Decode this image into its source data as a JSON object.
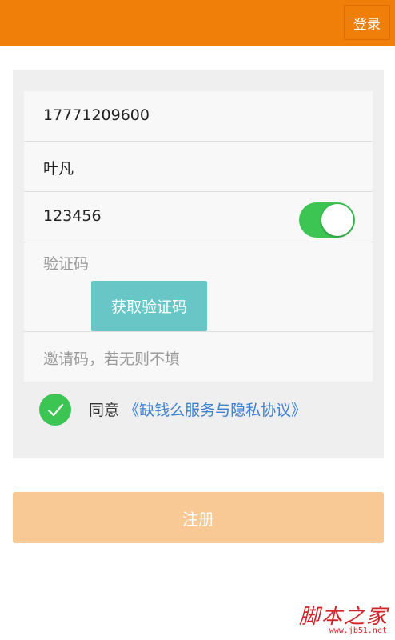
{
  "header": {
    "login_label": "登录",
    "bg_color": "#f07f0a"
  },
  "form": {
    "phone_value": "17771209600",
    "name_value": "叶凡",
    "password_value": "123456",
    "show_password_toggle_on": true,
    "verification_code_placeholder": "验证码",
    "get_code_label": "获取验证码",
    "invite_code_placeholder": "邀请码，若无则不填"
  },
  "agreement": {
    "checked": true,
    "prefix": "同意",
    "link_text": "《缺钱么服务与隐私协议》",
    "link_color": "#3a7fd0"
  },
  "register_label": "注册",
  "watermark": {
    "text": "脚本之家",
    "sub": "www.jb51.net"
  }
}
